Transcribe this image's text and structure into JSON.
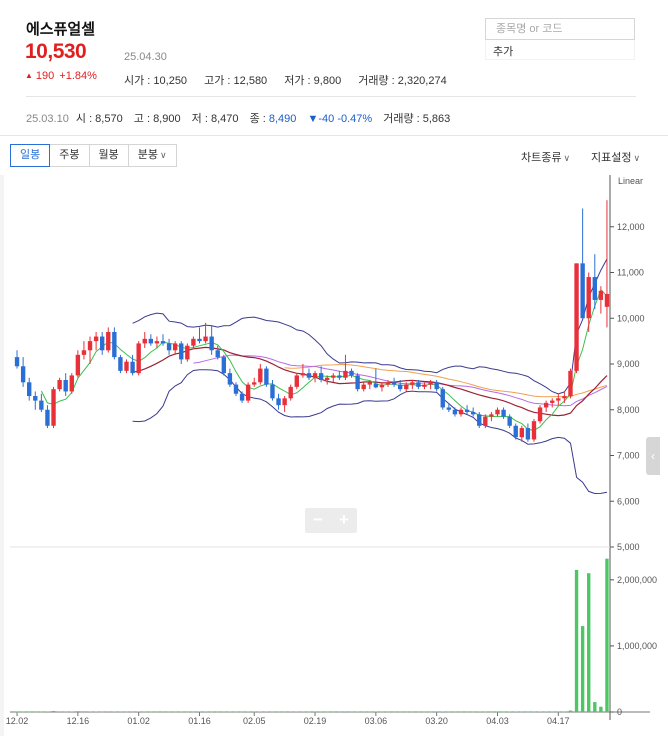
{
  "stock": {
    "name": "에스퓨얼셀",
    "price": "10,530",
    "change_arrow": "▲",
    "change": "190",
    "change_pct": "+1.84%",
    "date": "25.04.30",
    "open": "시가 : 10,250",
    "high": "고가 : 12,580",
    "low": "저가 : 9,800",
    "volume": "거래량 : 2,320,274"
  },
  "search": {
    "placeholder": "종목명 or 코드",
    "add_label": "추가"
  },
  "daily": {
    "date": "25.03.10",
    "open": "시 : 8,570",
    "high": "고 : 8,900",
    "low": "저 : 8,470",
    "close_label": "종 : ",
    "close": "8,490",
    "change": "▼-40",
    "change_pct": "-0.47%",
    "volume": "거래량 : 5,863"
  },
  "toolbar": {
    "tabs": [
      "일봉",
      "주봉",
      "월봉",
      "분봉"
    ],
    "chart_type": "차트종류",
    "indicator": "지표설정"
  },
  "colors": {
    "up": "#e8303a",
    "down": "#2a6fd6",
    "ma5": "#3bbf4e",
    "ma20": "#9b2335",
    "ma60": "#b76be6",
    "ma120": "#f0a050",
    "bollinger": "#3b3b8f",
    "volume": "#4cc763"
  },
  "chart_data": {
    "type": "candlestick",
    "scale_label": "Linear",
    "y_ticks": [
      "12,000",
      "11,000",
      "10,000",
      "9,000",
      "8,000",
      "7,000",
      "6,000",
      "5,000"
    ],
    "y_tick_values": [
      12000,
      11000,
      10000,
      9000,
      8000,
      7000,
      6000,
      5000
    ],
    "ylim": [
      5000,
      13000
    ],
    "volume_ticks": [
      "2,000,000",
      "1,000,000",
      "0"
    ],
    "volume_tick_values": [
      2000000,
      1000000,
      0
    ],
    "volume_lim": [
      0,
      2300000
    ],
    "x_ticks": [
      "12.02",
      "12.16",
      "01.02",
      "01.16",
      "02.05",
      "02.19",
      "03.06",
      "03.20",
      "04.03",
      "04.17"
    ],
    "x_tick_index": [
      0,
      10,
      20,
      30,
      39,
      49,
      59,
      69,
      79,
      89
    ],
    "ohlc": [
      [
        9150,
        9300,
        8900,
        8950
      ],
      [
        8950,
        9150,
        8500,
        8600
      ],
      [
        8600,
        8700,
        8200,
        8300
      ],
      [
        8300,
        8400,
        8000,
        8200
      ],
      [
        8200,
        8350,
        7950,
        8000
      ],
      [
        8000,
        8100,
        7600,
        7650
      ],
      [
        7650,
        8500,
        7600,
        8450
      ],
      [
        8450,
        8700,
        8400,
        8650
      ],
      [
        8650,
        8800,
        8300,
        8400
      ],
      [
        8400,
        8800,
        8350,
        8750
      ],
      [
        8750,
        9300,
        8700,
        9200
      ],
      [
        9200,
        9500,
        9100,
        9300
      ],
      [
        9300,
        9600,
        9000,
        9500
      ],
      [
        9500,
        9700,
        9300,
        9600
      ],
      [
        9600,
        9700,
        9200,
        9300
      ],
      [
        9300,
        9800,
        9250,
        9700
      ],
      [
        9700,
        9800,
        9100,
        9150
      ],
      [
        9150,
        9200,
        8800,
        8850
      ],
      [
        8850,
        9100,
        8800,
        9050
      ],
      [
        9050,
        9200,
        8750,
        8800
      ],
      [
        8800,
        9500,
        8750,
        9450
      ],
      [
        9450,
        9700,
        9350,
        9550
      ],
      [
        9550,
        9650,
        9400,
        9450
      ],
      [
        9450,
        9600,
        9350,
        9500
      ],
      [
        9500,
        9650,
        9400,
        9450
      ],
      [
        9450,
        9550,
        9200,
        9300
      ],
      [
        9300,
        9500,
        9200,
        9450
      ],
      [
        9450,
        9500,
        9000,
        9100
      ],
      [
        9100,
        9450,
        9050,
        9400
      ],
      [
        9400,
        9600,
        9350,
        9550
      ],
      [
        9550,
        9800,
        9450,
        9500
      ],
      [
        9500,
        9900,
        9450,
        9600
      ],
      [
        9600,
        9850,
        9200,
        9300
      ],
      [
        9300,
        9400,
        9100,
        9150
      ],
      [
        9150,
        9200,
        8750,
        8800
      ],
      [
        8800,
        8900,
        8500,
        8550
      ],
      [
        8550,
        8600,
        8300,
        8350
      ],
      [
        8350,
        8400,
        8150,
        8200
      ],
      [
        8200,
        8600,
        8150,
        8550
      ],
      [
        8550,
        8700,
        8500,
        8600
      ],
      [
        8600,
        9000,
        8550,
        8900
      ],
      [
        8900,
        8950,
        8500,
        8550
      ],
      [
        8550,
        8650,
        8200,
        8250
      ],
      [
        8250,
        8350,
        8000,
        8100
      ],
      [
        8100,
        8300,
        7950,
        8250
      ],
      [
        8250,
        8550,
        8200,
        8500
      ],
      [
        8500,
        8800,
        8450,
        8750
      ],
      [
        8750,
        9000,
        8700,
        8800
      ],
      [
        8800,
        8900,
        8650,
        8700
      ],
      [
        8700,
        8850,
        8600,
        8800
      ],
      [
        8800,
        8950,
        8600,
        8650
      ],
      [
        8650,
        8750,
        8550,
        8700
      ],
      [
        8700,
        8800,
        8600,
        8750
      ],
      [
        8750,
        8850,
        8650,
        8700
      ],
      [
        8700,
        9200,
        8650,
        8850
      ],
      [
        8850,
        8900,
        8700,
        8750
      ],
      [
        8750,
        8800,
        8400,
        8450
      ],
      [
        8450,
        8600,
        8400,
        8550
      ],
      [
        8550,
        8650,
        8450,
        8600
      ],
      [
        8570,
        8900,
        8470,
        8490
      ],
      [
        8490,
        8600,
        8400,
        8550
      ],
      [
        8550,
        8650,
        8500,
        8600
      ],
      [
        8600,
        8700,
        8500,
        8550
      ],
      [
        8550,
        8650,
        8400,
        8450
      ],
      [
        8450,
        8600,
        8400,
        8550
      ],
      [
        8550,
        8650,
        8450,
        8600
      ],
      [
        8600,
        8650,
        8450,
        8500
      ],
      [
        8500,
        8600,
        8450,
        8550
      ],
      [
        8550,
        8650,
        8450,
        8600
      ],
      [
        8600,
        8650,
        8400,
        8450
      ],
      [
        8450,
        8500,
        8000,
        8050
      ],
      [
        8050,
        8150,
        7950,
        8000
      ],
      [
        8000,
        8050,
        7850,
        7900
      ],
      [
        7900,
        8050,
        7850,
        8000
      ],
      [
        8000,
        8100,
        7900,
        7950
      ],
      [
        7950,
        8050,
        7850,
        7900
      ],
      [
        7900,
        7950,
        7600,
        7650
      ],
      [
        7650,
        7900,
        7600,
        7850
      ],
      [
        7850,
        7950,
        7750,
        7900
      ],
      [
        7900,
        8050,
        7850,
        8000
      ],
      [
        8000,
        8050,
        7800,
        7850
      ],
      [
        7850,
        7900,
        7600,
        7650
      ],
      [
        7650,
        7700,
        7350,
        7400
      ],
      [
        7400,
        7650,
        7300,
        7600
      ],
      [
        7600,
        7700,
        7300,
        7350
      ],
      [
        7350,
        7800,
        7300,
        7750
      ],
      [
        7750,
        8100,
        7700,
        8050
      ],
      [
        8050,
        8200,
        7950,
        8150
      ],
      [
        8150,
        8250,
        8050,
        8200
      ],
      [
        8200,
        8350,
        8100,
        8250
      ],
      [
        8250,
        8400,
        8150,
        8300
      ],
      [
        8300,
        8900,
        8250,
        8850
      ],
      [
        8850,
        11200,
        8800,
        11200
      ],
      [
        11200,
        12400,
        10000,
        10000
      ],
      [
        10000,
        11000,
        9700,
        10900
      ],
      [
        10900,
        11400,
        10200,
        10400
      ],
      [
        10400,
        10700,
        10100,
        10600
      ],
      [
        10250,
        12580,
        9800,
        10530
      ]
    ],
    "volume": [
      3000,
      5000,
      4000,
      3500,
      5000,
      8000,
      15000,
      9000,
      6000,
      7000,
      12000,
      10000,
      8000,
      7000,
      5000,
      9000,
      7000,
      6000,
      5000,
      4500,
      8000,
      6000,
      5000,
      4000,
      4500,
      5000,
      4000,
      5000,
      4500,
      5000,
      6000,
      7000,
      5000,
      4000,
      5000,
      6000,
      5000,
      4500,
      6000,
      5000,
      7000,
      6000,
      5000,
      4500,
      5000,
      6000,
      7000,
      6000,
      5000,
      4500,
      5000,
      4000,
      4500,
      5000,
      9000,
      5000,
      6000,
      5000,
      4500,
      5863,
      4500,
      4000,
      3500,
      4000,
      3500,
      4000,
      3500,
      4000,
      3500,
      4000,
      8000,
      5000,
      4000,
      3500,
      4000,
      3500,
      6000,
      5000,
      4000,
      3500,
      4000,
      6000,
      7000,
      5000,
      4000,
      5000,
      7000,
      6000,
      5000,
      4500,
      5000,
      22000,
      2150000,
      1300000,
      2100000,
      150000,
      80000,
      2320274
    ],
    "series": [
      {
        "key": "ma5"
      },
      {
        "key": "ma20"
      },
      {
        "key": "ma60"
      },
      {
        "key": "ma120"
      },
      {
        "key": "bollinger"
      }
    ]
  }
}
